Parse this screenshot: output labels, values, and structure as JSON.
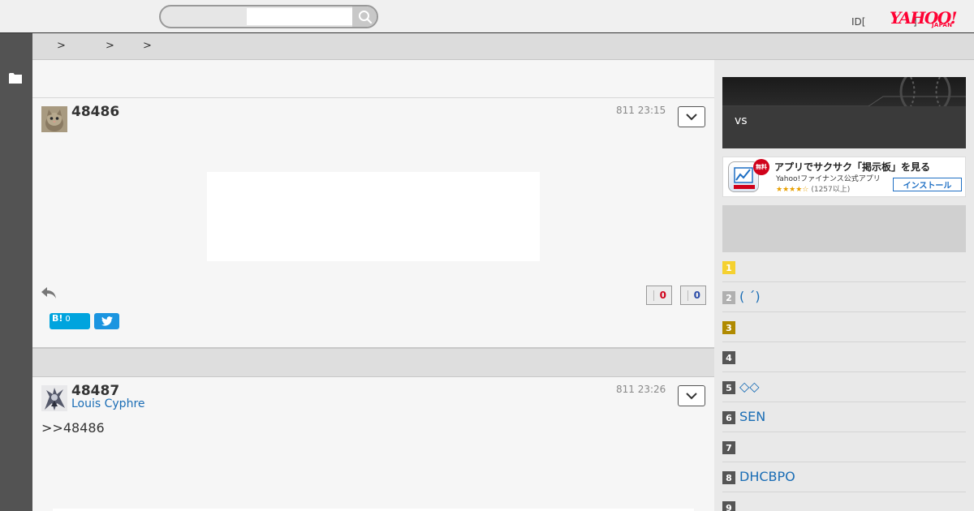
{
  "header": {
    "search": {
      "value": "",
      "placeholder": ""
    },
    "id_text": "ID[",
    "id_bracket": "]",
    "logo": {
      "main": "YAHOO!",
      "sub": "JAPAN"
    }
  },
  "breadcrumb": {
    "separators": [
      ">",
      ">",
      ">"
    ]
  },
  "posts": [
    {
      "number": "48486",
      "user": "",
      "time": "811 23:15",
      "body": "",
      "votes": {
        "up": "0",
        "down": "0"
      },
      "hatena": {
        "label": "B!",
        "count": "0"
      }
    },
    {
      "number": "48487",
      "user": "Louis Cyphre",
      "time": "811 23:26",
      "body": ">>48486"
    }
  ],
  "sidebar": {
    "banner_text": "vs",
    "app_ad": {
      "free_badge": "無料",
      "title": "アプリでサクサク「掲示板」を見る",
      "subtitle": "Yahoo!ファイナンス公式アプリ",
      "stars": "★★★★☆",
      "rating": "(1257以上)",
      "install_label": "インストール"
    },
    "ranking": [
      {
        "num": "1",
        "label": ""
      },
      {
        "num": "2",
        "label": "( ´)"
      },
      {
        "num": "3",
        "label": ""
      },
      {
        "num": "4",
        "label": ""
      },
      {
        "num": "5",
        "label": "◇◇"
      },
      {
        "num": "6",
        "label": "SEN"
      },
      {
        "num": "7",
        "label": ""
      },
      {
        "num": "8",
        "label": "DHCBPO"
      },
      {
        "num": "9",
        "label": ""
      }
    ],
    "rank_colors": [
      "#f5d130",
      "#b0b0b0",
      "#b08a00",
      "#555555",
      "#555555",
      "#555555",
      "#555555",
      "#555555",
      "#555555"
    ]
  },
  "icons": {
    "search": "search-icon",
    "folder": "folder-icon",
    "menu": "chevron-down-icon",
    "reply": "reply-icon",
    "twitter": "twitter-icon"
  }
}
